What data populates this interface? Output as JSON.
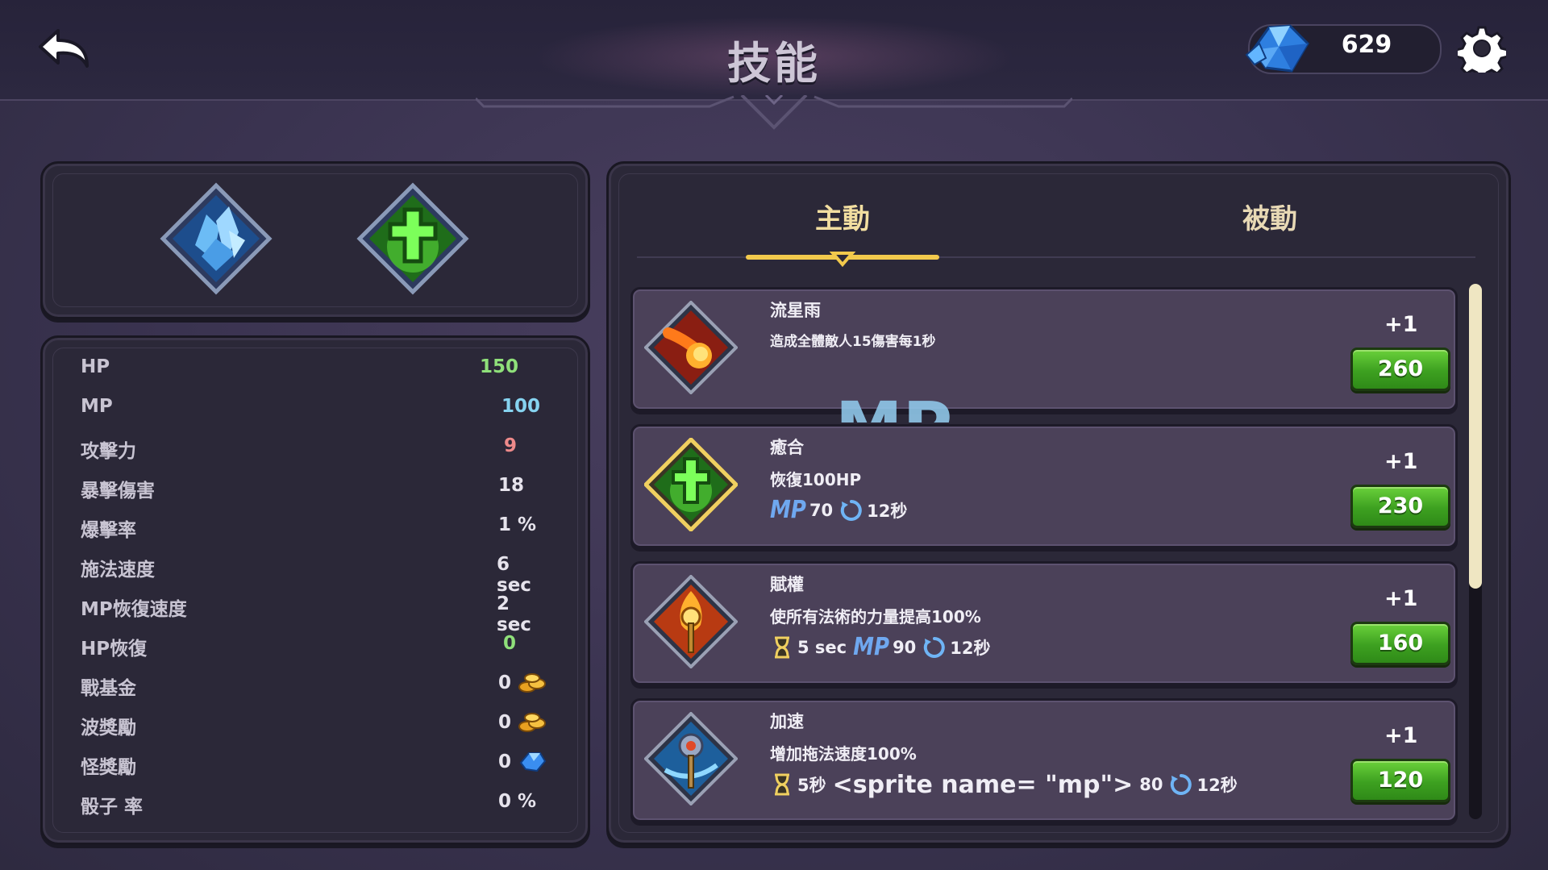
{
  "header": {
    "title": "技能",
    "gem_count": "629"
  },
  "equipped_skills": [
    {
      "name": "ice-crystal-skill-icon"
    },
    {
      "name": "heal-cross-skill-icon"
    }
  ],
  "stats": [
    {
      "label": "HP",
      "value": "150",
      "color": "#8fe07a"
    },
    {
      "label": "MP",
      "value": "100",
      "color": "#86d3f0"
    },
    {
      "label": "攻擊力",
      "value": "9",
      "color": "#ee8a8a"
    },
    {
      "label": "暴擊傷害",
      "value": "18",
      "color": "#e6e3ec"
    },
    {
      "label": "爆擊率",
      "value": "1 %",
      "color": "#e6e3ec"
    },
    {
      "label": "施法速度",
      "value": "6 sec",
      "color": "#e6e3ec"
    },
    {
      "label": "MP恢復速度",
      "value": "2 sec",
      "color": "#e6e3ec"
    },
    {
      "label": "HP恢復",
      "value": "0",
      "color": "#8fe07a"
    },
    {
      "label": "戰基金",
      "value": "0",
      "color": "#e6e3ec",
      "icon": "gold-coins-icon"
    },
    {
      "label": "波獎勵",
      "value": "0",
      "color": "#e6e3ec",
      "icon": "gold-coins-icon"
    },
    {
      "label": "怪獎勵",
      "value": "0",
      "color": "#e6e3ec",
      "icon": "blue-gem-icon"
    },
    {
      "label": "骰子 率",
      "value": "0 %",
      "color": "#e6e3ec"
    }
  ],
  "tabs": {
    "active": "主動",
    "passive": "被動"
  },
  "skills": [
    {
      "name": "流星雨",
      "description": "造成全體敵人15傷害每1秒",
      "level_up": "+1",
      "cost": "260",
      "icon": "meteor-icon",
      "meta": []
    },
    {
      "name": "癒合",
      "description": "恢復100HP",
      "level_up": "+1",
      "cost": "230",
      "icon": "heal-cross-icon",
      "meta": [
        {
          "type": "mp",
          "text": "MP"
        },
        {
          "type": "text",
          "text": "70"
        },
        {
          "type": "cooldown"
        },
        {
          "type": "text",
          "text": "12秒"
        }
      ]
    },
    {
      "name": "賦權",
      "description": "使所有法術的力量提高100%",
      "level_up": "+1",
      "cost": "160",
      "icon": "empower-staff-icon",
      "meta": [
        {
          "type": "hourglass"
        },
        {
          "type": "text",
          "text": "5 sec"
        },
        {
          "type": "mp",
          "text": "MP"
        },
        {
          "type": "text",
          "text": "90"
        },
        {
          "type": "cooldown"
        },
        {
          "type": "text",
          "text": "12秒"
        }
      ]
    },
    {
      "name": "加速",
      "description": "增加拖法速度100%",
      "level_up": "+1",
      "cost": "120",
      "icon": "haste-staff-icon",
      "meta": [
        {
          "type": "hourglass"
        },
        {
          "type": "text",
          "text": "5秒"
        },
        {
          "type": "raw",
          "text": "<sprite name= \"mp\">"
        },
        {
          "type": "text",
          "text": "80"
        },
        {
          "type": "cooldown"
        },
        {
          "type": "text",
          "text": "12秒"
        }
      ]
    }
  ],
  "overlay_text": "MP",
  "colors": {
    "accent_gold": "#f2dea0",
    "button_green": "#3da020",
    "mp_blue": "#6fa8f0"
  }
}
